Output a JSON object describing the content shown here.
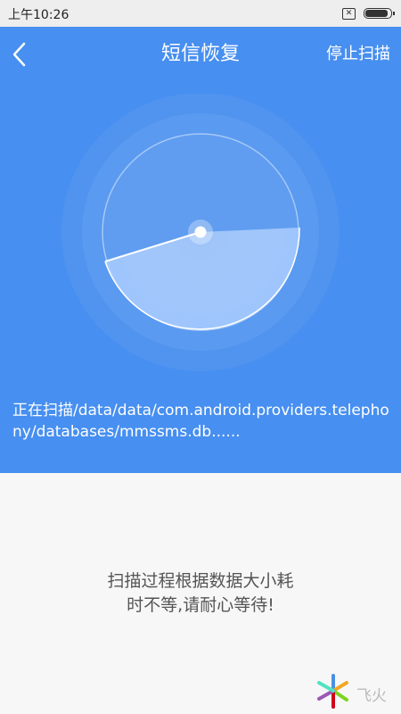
{
  "status_bar": {
    "time": "上午10:26",
    "battery_level": 0.9
  },
  "header": {
    "title": "短信恢复",
    "stop_label": "停止扫描"
  },
  "scan": {
    "path_text": "正在扫描/data/data/com.android.providers.telephony/databases/mmssms.db......"
  },
  "hint": {
    "line1": "扫描过程根据数据大小耗",
    "line2": "时不等,请耐心等待!"
  },
  "watermark": {
    "text": "飞火"
  },
  "colors": {
    "primary": "#478ff0",
    "background": "#f7f7f7"
  }
}
